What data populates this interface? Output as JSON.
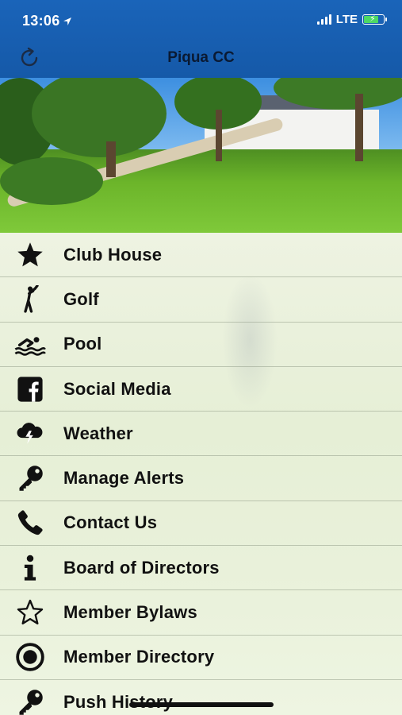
{
  "status_bar": {
    "time": "13:06",
    "network": "LTE"
  },
  "header": {
    "title": "Piqua CC"
  },
  "menu": {
    "items": [
      {
        "label": "Club House",
        "icon": "star-icon"
      },
      {
        "label": "Golf",
        "icon": "golfer-icon"
      },
      {
        "label": "Pool",
        "icon": "swimmer-icon"
      },
      {
        "label": "Social Media",
        "icon": "facebook-icon"
      },
      {
        "label": "Weather",
        "icon": "storm-cloud-icon"
      },
      {
        "label": "Manage Alerts",
        "icon": "key-icon"
      },
      {
        "label": "Contact Us",
        "icon": "phone-icon"
      },
      {
        "label": "Board of Directors",
        "icon": "info-icon"
      },
      {
        "label": "Member Bylaws",
        "icon": "star-outline-icon"
      },
      {
        "label": "Member Directory",
        "icon": "radio-circle-icon"
      },
      {
        "label": "Push History",
        "icon": "key-icon"
      }
    ]
  },
  "colors": {
    "header_bg": "#1a64b9",
    "title_text": "#0a1a33",
    "battery": "#4cd964"
  }
}
